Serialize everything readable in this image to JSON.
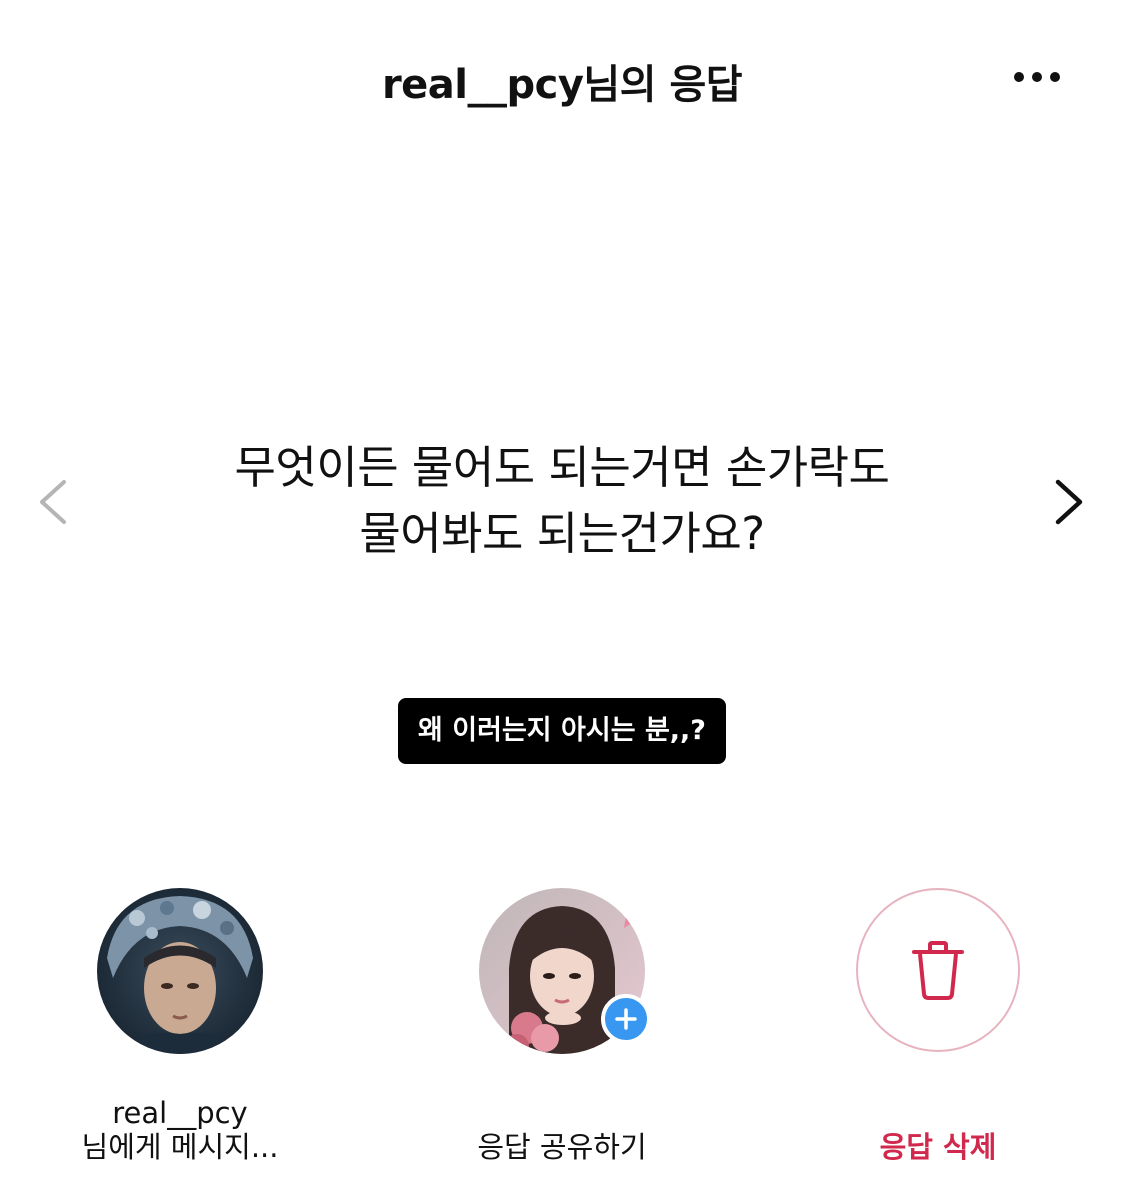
{
  "header": {
    "title": "real__pcy님의 응답",
    "more_icon": "more-horizontal-icon"
  },
  "navigation": {
    "prev_icon": "chevron-left-icon",
    "next_icon": "chevron-right-icon"
  },
  "question": {
    "line1": "무엇이든 물어도 되는거면 손가락도",
    "line2": "물어봐도 되는건가요?"
  },
  "answer": {
    "text": "왜 이러는지 아시는 분,,?"
  },
  "actions": [
    {
      "type": "message",
      "label_line1": "real__pcy",
      "label_line2": "님에게 메시지...",
      "icon": "avatar"
    },
    {
      "type": "share",
      "label": "응답 공유하기",
      "icon": "avatar-with-plus"
    },
    {
      "type": "delete",
      "label": "응답 삭제",
      "icon": "trash-icon",
      "color": "#d0294d"
    }
  ],
  "colors": {
    "accent_blue": "#3897f0",
    "delete_red": "#d0294d",
    "badge_bg": "#000000"
  }
}
